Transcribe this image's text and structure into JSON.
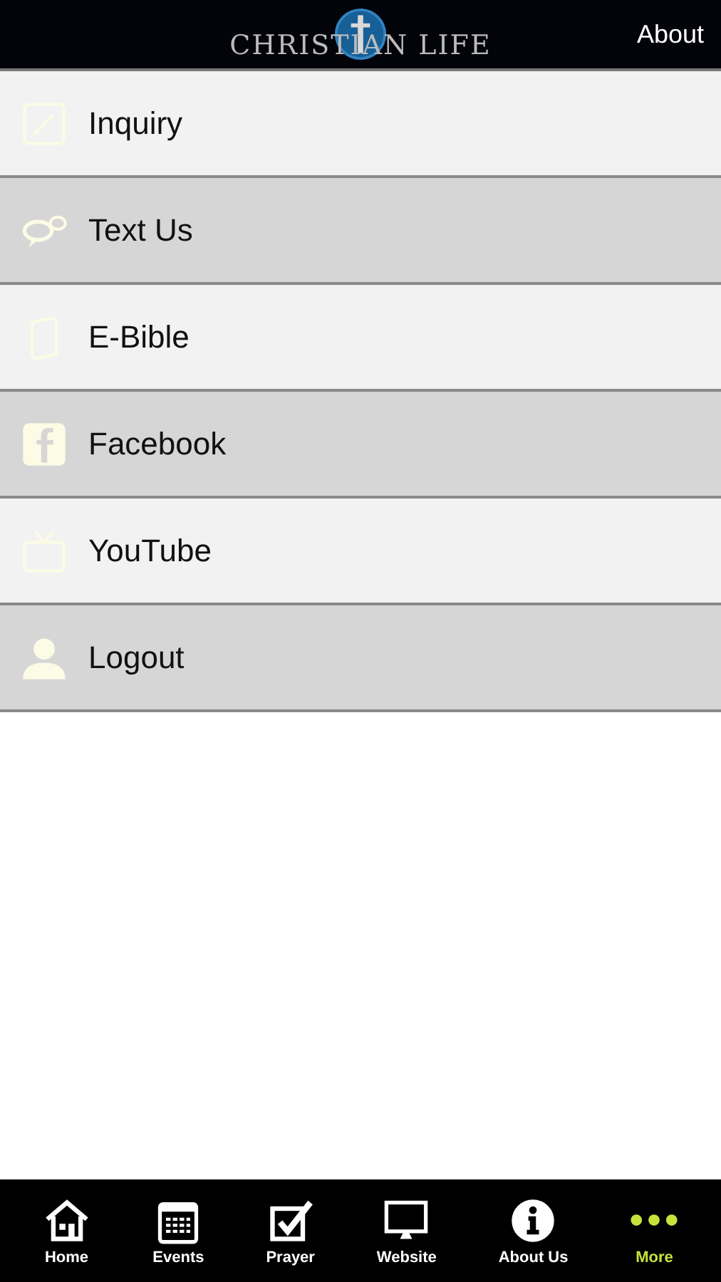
{
  "header": {
    "logo": "CHRISTIAN LIFE",
    "action": "About"
  },
  "menu": [
    {
      "label": "Inquiry"
    },
    {
      "label": "Text Us"
    },
    {
      "label": "E-Bible"
    },
    {
      "label": "Facebook"
    },
    {
      "label": "YouTube"
    },
    {
      "label": "Logout"
    }
  ],
  "tabs": [
    {
      "label": "Home",
      "selected": false
    },
    {
      "label": "Events",
      "selected": false
    },
    {
      "label": "Prayer",
      "selected": false
    },
    {
      "label": "Website",
      "selected": false
    },
    {
      "label": "About Us",
      "selected": false
    },
    {
      "label": "More",
      "selected": true
    }
  ]
}
